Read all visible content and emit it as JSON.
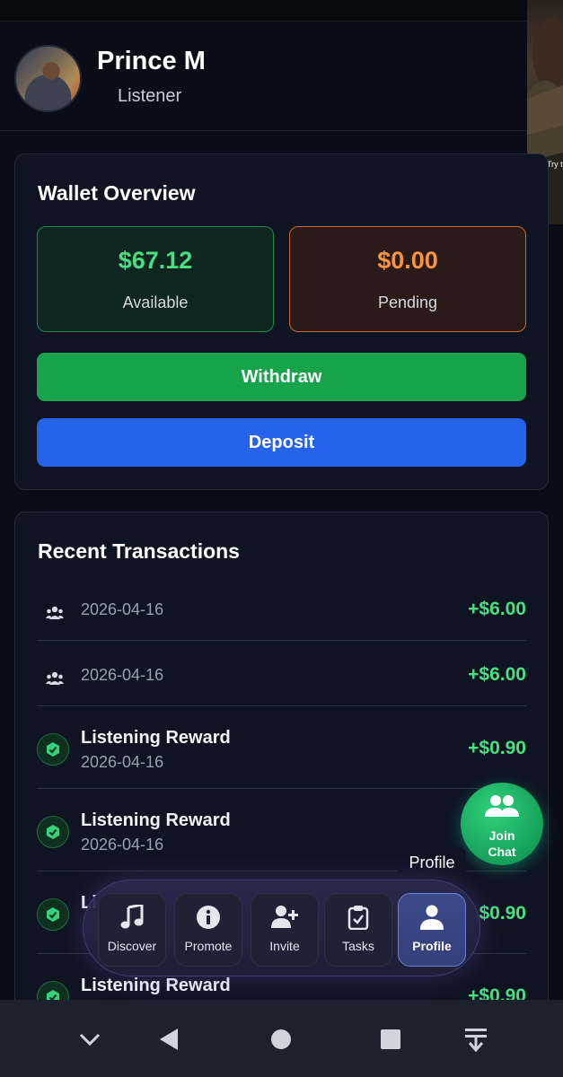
{
  "profile": {
    "name": "Prince M",
    "role": "Listener"
  },
  "video_pip": {
    "caption": "Try t"
  },
  "wallet": {
    "title": "Wallet Overview",
    "available": {
      "value": "$67.12",
      "label": "Available"
    },
    "pending": {
      "value": "$0.00",
      "label": "Pending"
    },
    "withdraw_label": "Withdraw",
    "deposit_label": "Deposit"
  },
  "transactions": {
    "title": "Recent Transactions",
    "items": [
      {
        "type": "referral",
        "title": "",
        "date": "2026-04-16",
        "amount": "+$6.00"
      },
      {
        "type": "referral",
        "title": "",
        "date": "2026-04-16",
        "amount": "+$6.00"
      },
      {
        "type": "reward",
        "title": "Listening Reward",
        "date": "2026-04-16",
        "amount": "+$0.90"
      },
      {
        "type": "reward",
        "title": "Listening Reward",
        "date": "2026-04-16",
        "amount": ""
      },
      {
        "type": "reward",
        "title": "Li",
        "date": "",
        "amount": "$0.90"
      },
      {
        "type": "reward",
        "title": "Listening Reward",
        "date": "",
        "amount": "+$0.90"
      }
    ]
  },
  "join_chat": {
    "label_line1": "Join",
    "label_line2": "Chat"
  },
  "tooltip": "Profile",
  "bottom_nav": {
    "items": [
      {
        "label": "Discover",
        "icon": "music-note-icon"
      },
      {
        "label": "Promote",
        "icon": "info-icon"
      },
      {
        "label": "Invite",
        "icon": "add-user-icon"
      },
      {
        "label": "Tasks",
        "icon": "clipboard-check-icon"
      },
      {
        "label": "Profile",
        "icon": "user-icon",
        "active": true
      }
    ]
  },
  "colors": {
    "background": "#0a0d17",
    "card": "#0f1422",
    "positive": "#4ade80",
    "pending": "#fb923c",
    "withdraw": "#16a34a",
    "deposit": "#2563eb",
    "nav_active": "#3d4a8a"
  }
}
